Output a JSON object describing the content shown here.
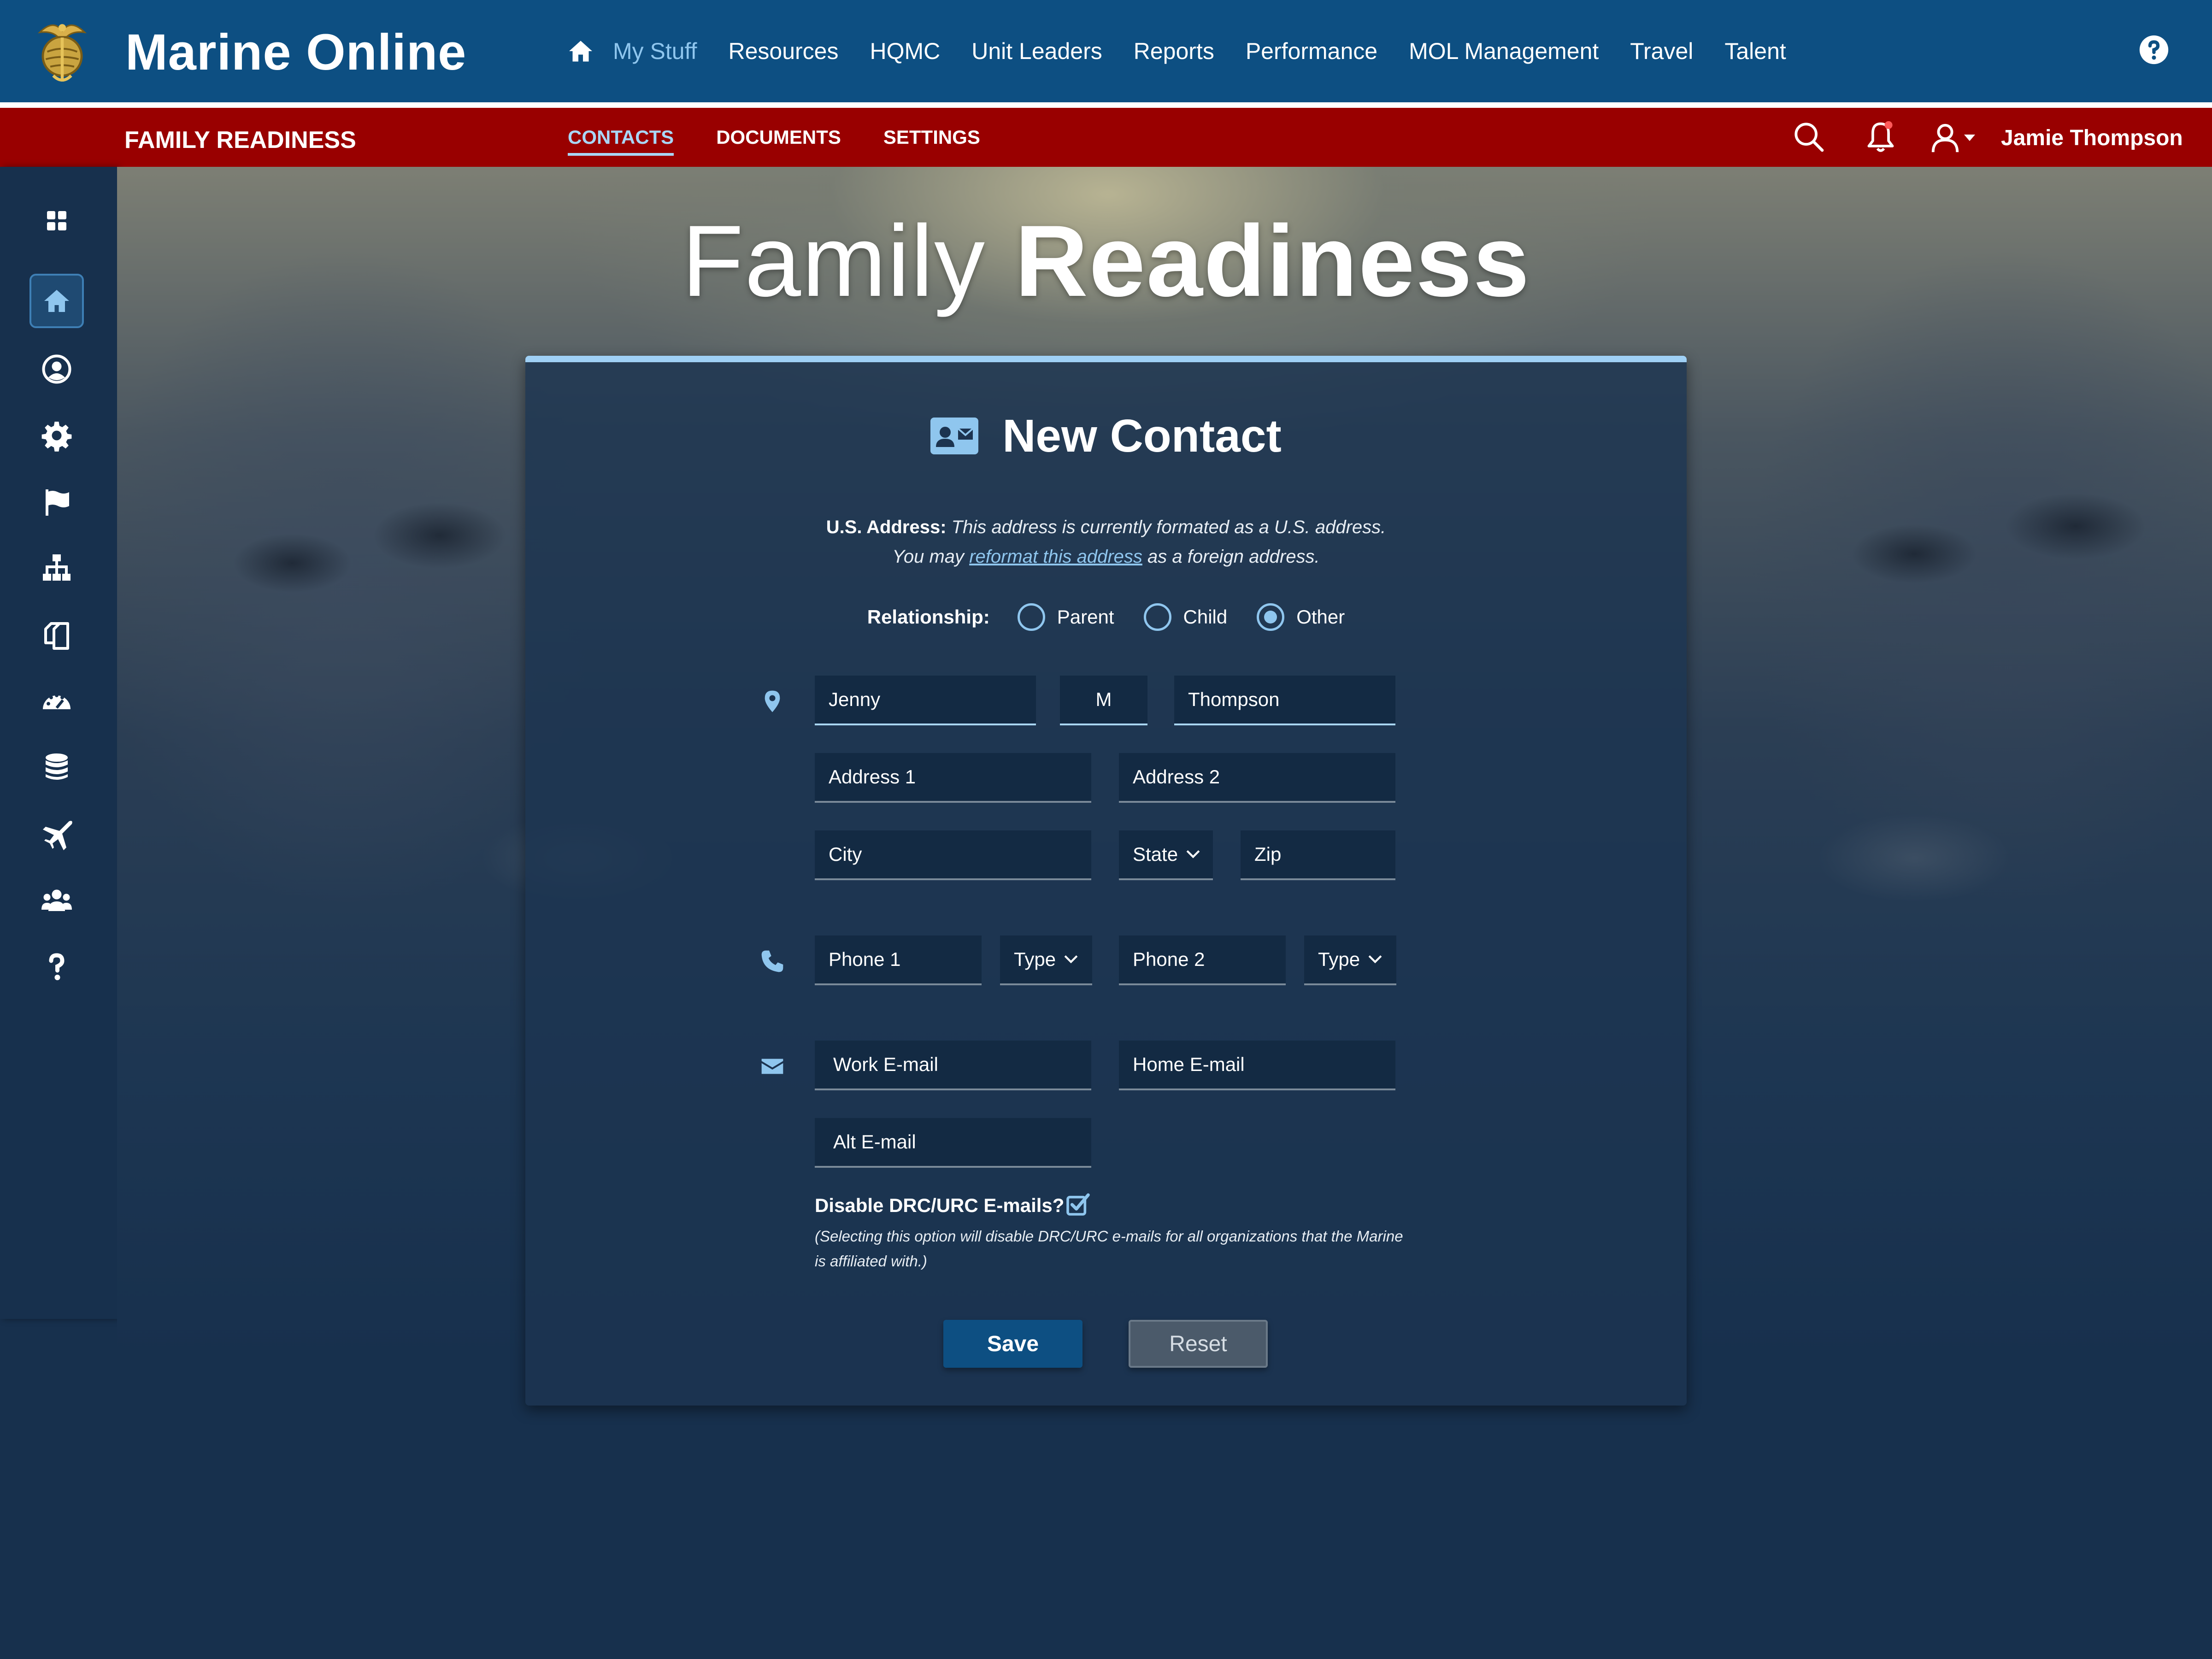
{
  "app": {
    "title": "Marine Online",
    "brand_color": "#0d4f82",
    "accent_red": "#990000"
  },
  "topnav": {
    "items": [
      {
        "label": "My Stuff",
        "active": true
      },
      {
        "label": "Resources"
      },
      {
        "label": "HQMC"
      },
      {
        "label": "Unit Leaders"
      },
      {
        "label": "Reports"
      },
      {
        "label": "Performance"
      },
      {
        "label": "MOL Management"
      },
      {
        "label": "Travel"
      },
      {
        "label": "Talent"
      }
    ],
    "icons": [
      "home-icon",
      "help-icon"
    ]
  },
  "subbar": {
    "module_title": "FAMILY READINESS",
    "tabs": [
      {
        "label": "CONTACTS",
        "active": true
      },
      {
        "label": "DOCUMENTS"
      },
      {
        "label": "SETTINGS"
      }
    ],
    "user_name": "Jamie Thompson",
    "icons": [
      "search-icon",
      "bell-icon",
      "user-icon"
    ]
  },
  "sidebar": {
    "icons": [
      "grid-icon",
      "home-icon",
      "profile-icon",
      "gear-icon",
      "flag-icon",
      "org-chart-icon",
      "documents-icon",
      "dashboard-icon",
      "database-icon",
      "plane-icon",
      "group-icon",
      "question-icon"
    ],
    "active": "home-icon"
  },
  "hero": {
    "title_light": "Family",
    "title_bold": "Readiness"
  },
  "form": {
    "title": "New Contact",
    "address_note": {
      "label": "U.S. Address:",
      "text1": "This address is currently formated as a U.S. address.",
      "text2_before": "You may",
      "link": "reformat this address",
      "text2_after": "as a foreign address."
    },
    "relationship": {
      "label": "Relationship:",
      "options": [
        "Parent",
        "Child",
        "Other"
      ],
      "selected": "Other"
    },
    "first_name": "Jenny",
    "middle_initial": "M",
    "last_name": "Thompson",
    "placeholders": {
      "address1": "Address 1",
      "address2": "Address 2",
      "city": "City",
      "state": "State",
      "zip": "Zip",
      "phone1": "Phone 1",
      "phone_type1": "Type",
      "phone2": "Phone 2",
      "phone_type2": "Type",
      "work_email": "Work E-mail",
      "home_email": "Home E-mail",
      "alt_email": "Alt E-mail"
    },
    "disable_emails": {
      "label": "Disable DRC/URC E-mails?",
      "checked": true,
      "note": "(Selecting this option will disable DRC/URC e-mails for all organizations that the Marine is affiliated with.)"
    },
    "buttons": {
      "save": "Save",
      "reset": "Reset"
    }
  }
}
